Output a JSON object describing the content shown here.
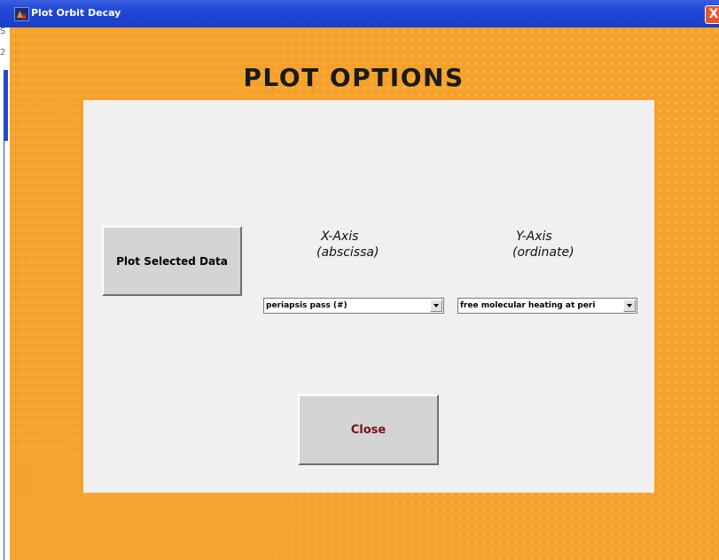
{
  "window": {
    "title": "Plot Orbit Decay",
    "close_glyph": "X"
  },
  "left_strip": {
    "glyphs": [
      "S",
      "2"
    ]
  },
  "figure": {
    "heading": "PLOT OPTIONS",
    "background_color": "#f5a22d",
    "panel_color": "#f0f0f0"
  },
  "controls": {
    "plot_button_label": "Plot Selected Data",
    "close_button_label": "Close",
    "x_axis": {
      "label_line1": "X-Axis",
      "label_line2": "(abscissa)",
      "selected": "periapsis pass (#)"
    },
    "y_axis": {
      "label_line1": "Y-Axis",
      "label_line2": "(ordinate)",
      "selected": "free molecular heating at peri"
    }
  },
  "icons": {
    "app": "matlab-figure-icon",
    "close": "close-icon",
    "dropdown": "dropdown-arrow-icon"
  }
}
